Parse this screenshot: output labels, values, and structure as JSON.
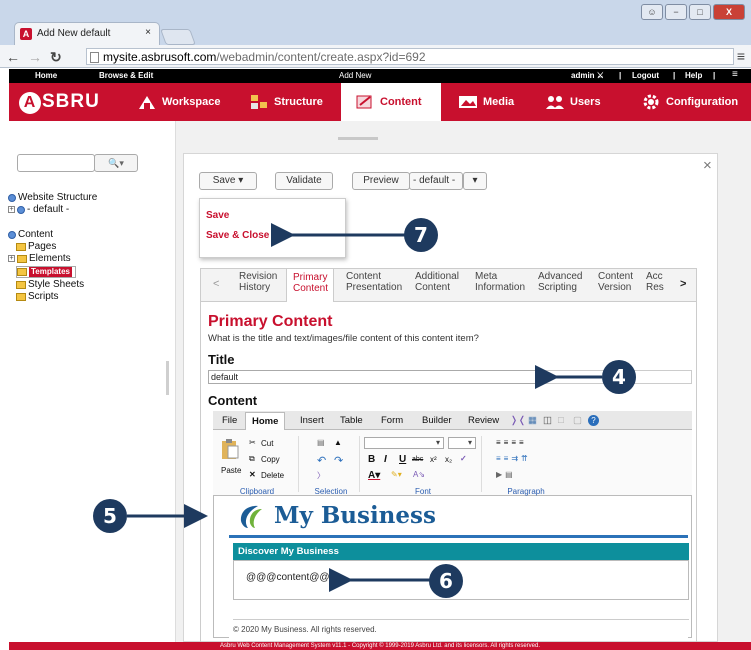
{
  "browser": {
    "tab_title": "Add New default",
    "tab_close": "×",
    "url_domain": "mysite.asbrusoft.com",
    "url_path": "/webadmin/content/create.aspx?id=692",
    "window_buttons": [
      "−",
      "□",
      "X"
    ]
  },
  "topbar": {
    "home": "Home",
    "browse_edit": "Browse & Edit",
    "center": "Add New",
    "user": "admin ⚔",
    "logout": "Logout",
    "help": "Help",
    "separator": "|",
    "menu": "≡"
  },
  "mainnav": {
    "logo": "SBRU",
    "logo_letter": "A",
    "items": [
      "Workspace",
      "Structure",
      "Content",
      "Media",
      "Users",
      "Configuration"
    ],
    "active": "Content"
  },
  "sidebar": {
    "search_btn": "🔍▾",
    "tree": [
      {
        "label": "Website Structure"
      },
      {
        "label": "- default -"
      },
      {
        "label": "Content"
      },
      {
        "label": "Pages"
      },
      {
        "label": "Elements"
      },
      {
        "label": "Templates"
      },
      {
        "label": "Style Sheets"
      },
      {
        "label": "Scripts"
      }
    ]
  },
  "toolbar": {
    "save": "Save ▾",
    "validate": "Validate",
    "preview": "Preview",
    "preview_select": "- default -",
    "close": "×"
  },
  "save_menu": {
    "save": "Save",
    "save_close": "Save & Close"
  },
  "tabs": {
    "prev": "<",
    "next": ">",
    "items": [
      {
        "label": "Revision History"
      },
      {
        "label": "Primary Content"
      },
      {
        "label": "Content Presentation"
      },
      {
        "label": "Additional Content"
      },
      {
        "label": "Meta Information"
      },
      {
        "label": "Advanced Scripting"
      },
      {
        "label": "Content Version"
      },
      {
        "label": "Acc Res"
      }
    ]
  },
  "primary": {
    "heading": "Primary Content",
    "description": "What is the title and text/images/file content of this content item?",
    "title_label": "Title",
    "title_value": "default",
    "content_label": "Content"
  },
  "editor": {
    "tabs": [
      "File",
      "Home",
      "Insert",
      "Table",
      "Form",
      "Builder",
      "Review"
    ],
    "active_tab": "Home",
    "clipboard": {
      "paste": "Paste",
      "cut": "Cut",
      "copy": "Copy",
      "delete": "Delete",
      "group": "Clipboard"
    },
    "selection_group": "Selection",
    "font_group": "Font",
    "paragraph_group": "Paragraph",
    "font_buttons": [
      "B",
      "I",
      "U",
      "abc",
      "x²",
      "x₂"
    ]
  },
  "page_preview": {
    "business_name": "My Business",
    "discover": "Discover My Business",
    "content_placeholder": "@@@content@@@",
    "footer": "© 2020 My Business. All rights reserved."
  },
  "status": "Asbru Web Content Management System v11.1 - Copyright © 1999-2019 Asbru Ltd. and its licensors. All rights reserved.",
  "callouts": [
    "7",
    "4",
    "5",
    "6"
  ],
  "colors": {
    "brand": "#c8102e",
    "callout": "#1e3a5f",
    "teal": "#0d8f9c",
    "business_blue": "#1b5c96"
  }
}
